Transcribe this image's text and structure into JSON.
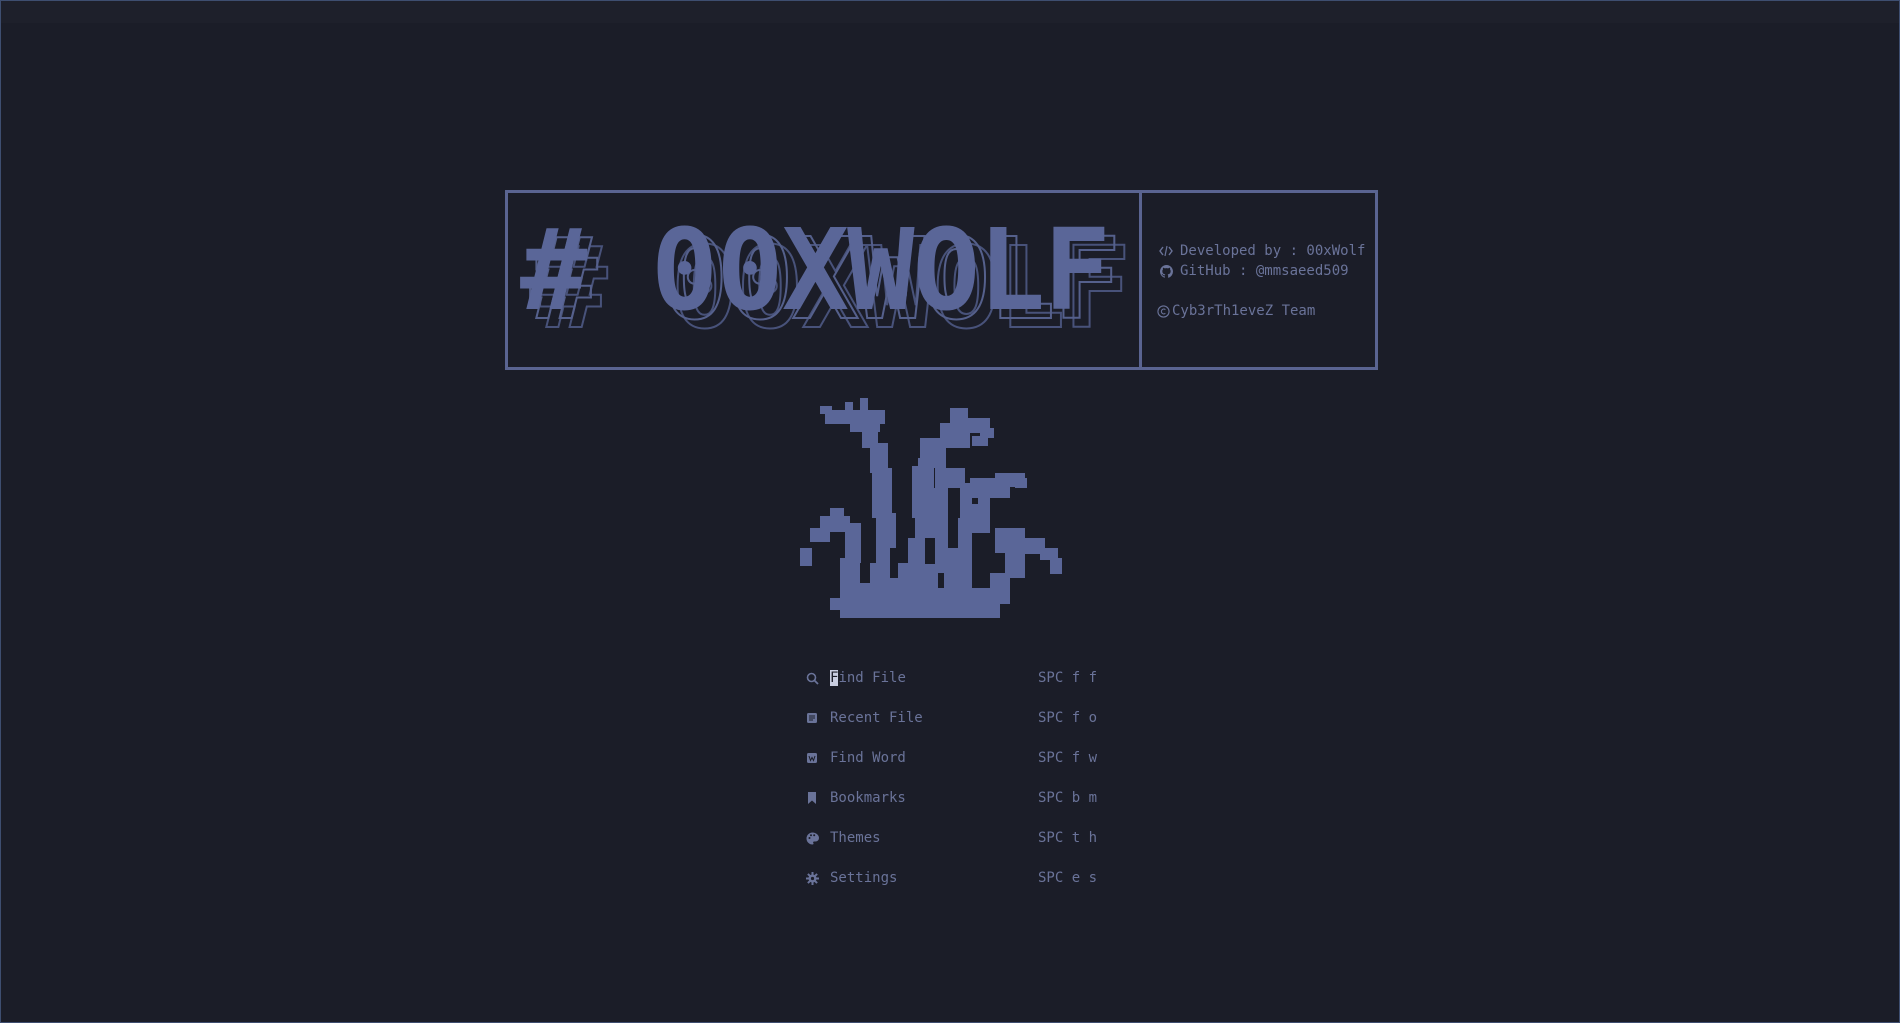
{
  "colors": {
    "background": "#1b1d28",
    "accent": "#5a6698",
    "text": "#6a7399",
    "border": "#5a6491"
  },
  "header": {
    "logo_text": "# 00XWOLF",
    "info": {
      "developer": "Developed by : 00xWolf",
      "github": "GitHub : @mmsaeed509",
      "team": "Cyb3rTh1eveZ Team"
    }
  },
  "menu": {
    "items": [
      {
        "icon": "search-icon",
        "first": "F",
        "rest": "ind File",
        "key": "SPC f f"
      },
      {
        "icon": "file-text-icon",
        "label": "Recent File",
        "key": "SPC f o"
      },
      {
        "icon": "word-icon",
        "label": "Find Word",
        "key": "SPC f w"
      },
      {
        "icon": "bookmark-icon",
        "label": "Bookmarks",
        "key": "SPC b m"
      },
      {
        "icon": "palette-icon",
        "label": "Themes",
        "key": "SPC t h"
      },
      {
        "icon": "gear-icon",
        "label": "Settings",
        "key": "SPC e s"
      }
    ]
  }
}
